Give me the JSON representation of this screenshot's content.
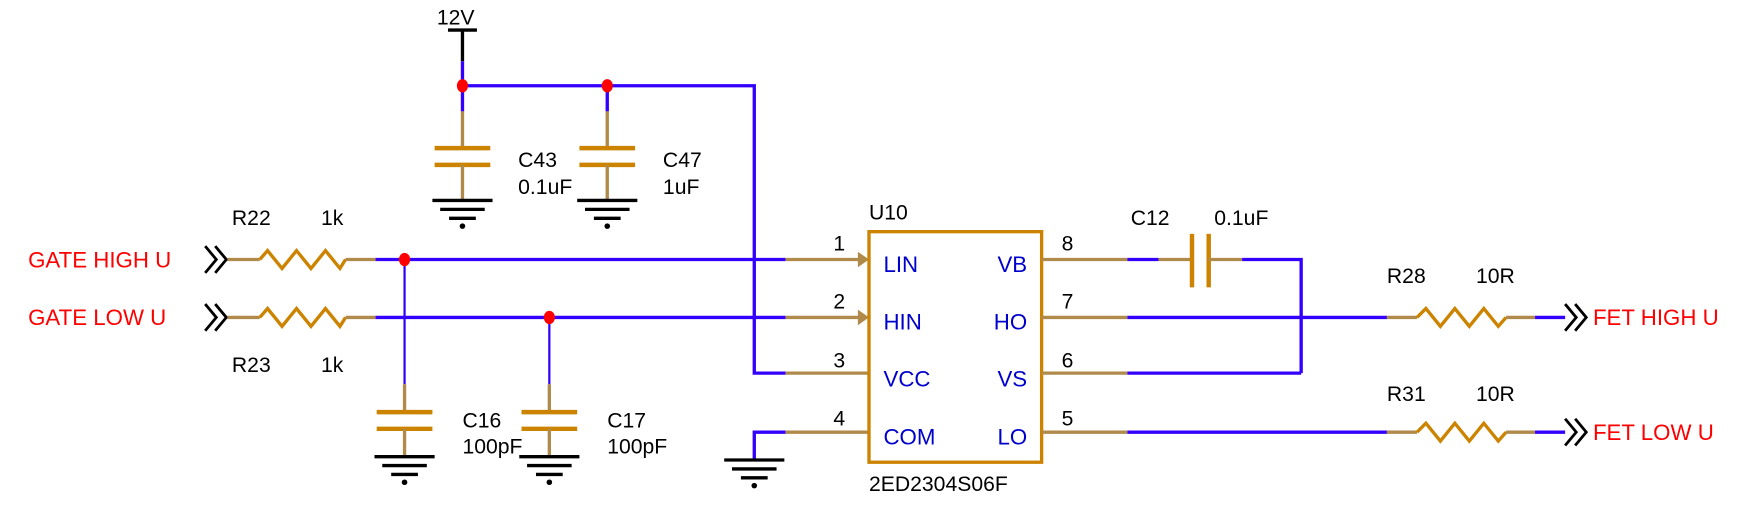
{
  "colors": {
    "wire": "#3300ff",
    "pin_lead": "#b08a4a",
    "component": "#cc8400",
    "net_label": "#ff0000",
    "junction": "#ff0000",
    "pin_name": "#0000cc"
  },
  "power": {
    "label": "12V"
  },
  "nets": {
    "gate_high": "GATE HIGH U",
    "gate_low": "GATE LOW U",
    "fet_high": "FET HIGH U",
    "fet_low": "FET LOW U"
  },
  "resistors": [
    {
      "ref": "R22",
      "value": "1k"
    },
    {
      "ref": "R23",
      "value": "1k"
    },
    {
      "ref": "R28",
      "value": "10R"
    },
    {
      "ref": "R31",
      "value": "10R"
    }
  ],
  "capacitors": [
    {
      "ref": "C43",
      "value": "0.1uF"
    },
    {
      "ref": "C47",
      "value": "1uF"
    },
    {
      "ref": "C16",
      "value": "100pF"
    },
    {
      "ref": "C17",
      "value": "100pF"
    },
    {
      "ref": "C12",
      "value": "0.1uF"
    }
  ],
  "ic": {
    "ref": "U10",
    "part": "2ED2304S06F",
    "left_pins": [
      {
        "num": "1",
        "name": "LIN"
      },
      {
        "num": "2",
        "name": "HIN"
      },
      {
        "num": "3",
        "name": "VCC"
      },
      {
        "num": "4",
        "name": "COM"
      }
    ],
    "right_pins": [
      {
        "num": "8",
        "name": "VB"
      },
      {
        "num": "7",
        "name": "HO"
      },
      {
        "num": "6",
        "name": "VS"
      },
      {
        "num": "5",
        "name": "LO"
      }
    ]
  }
}
